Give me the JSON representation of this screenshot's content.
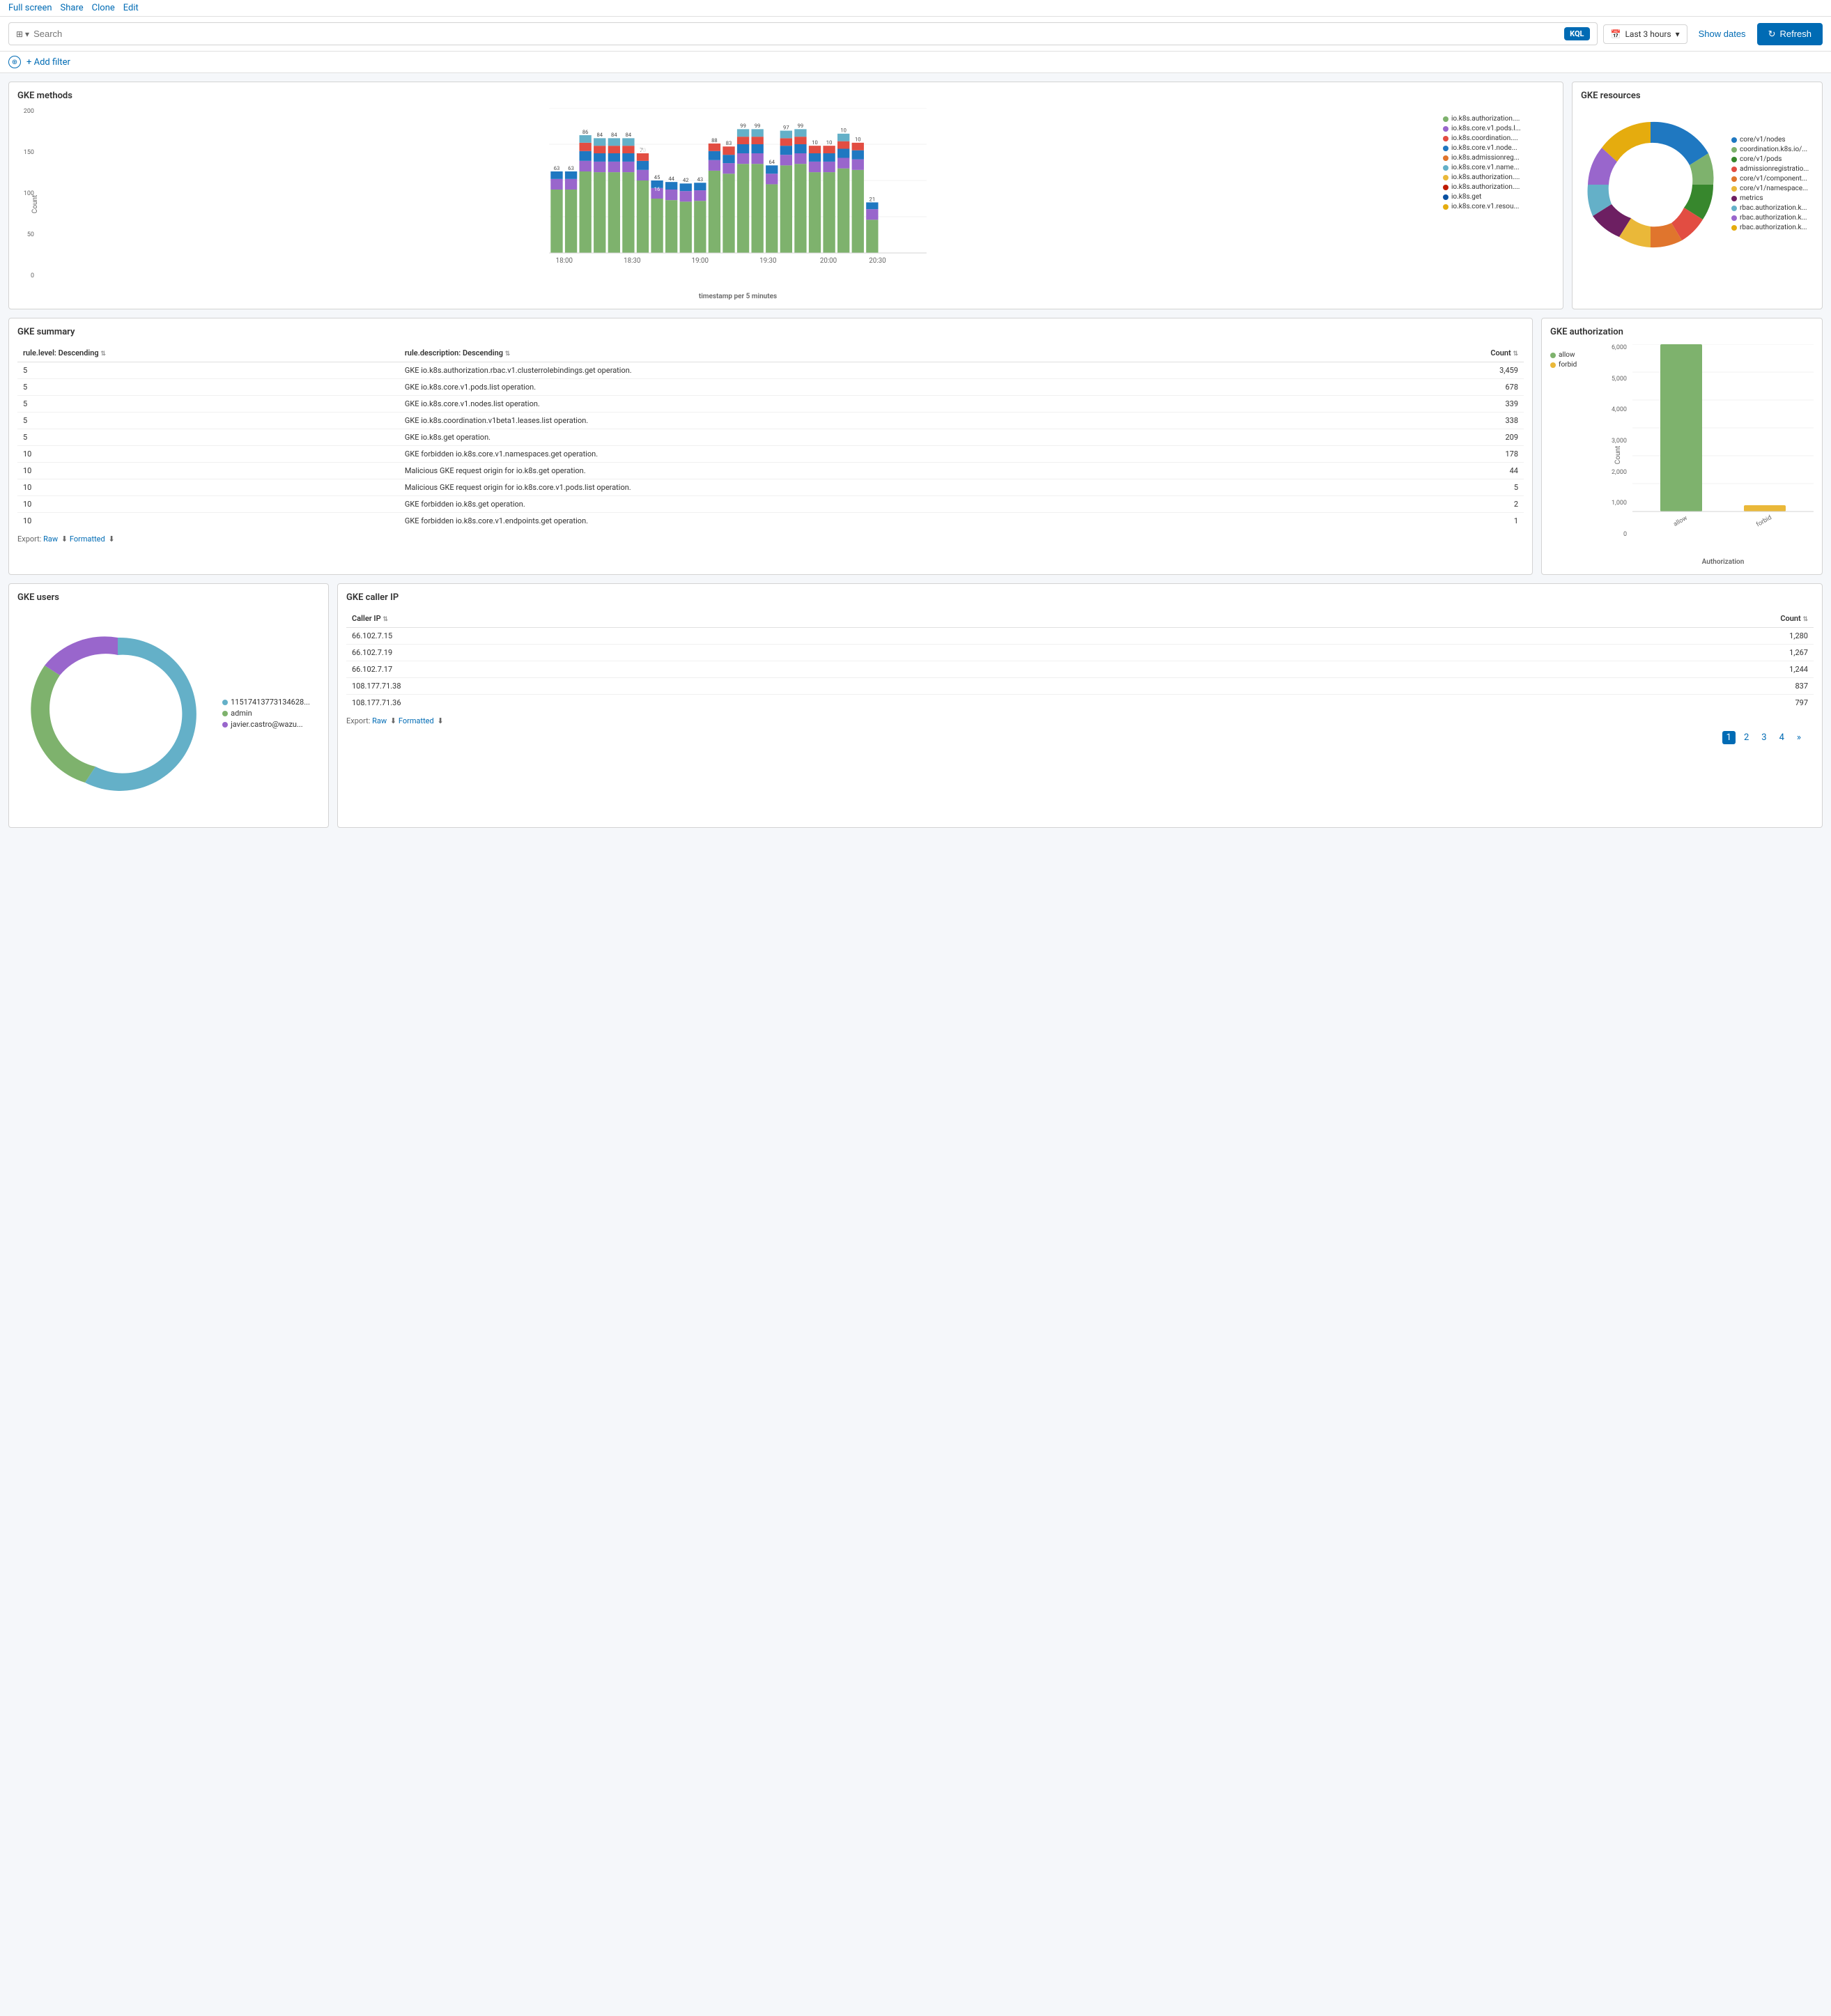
{
  "topbar": {
    "fullscreen": "Full screen",
    "share": "Share",
    "clone": "Clone",
    "edit": "Edit"
  },
  "toolbar": {
    "search_placeholder": "Search",
    "kql_label": "KQL",
    "calendar_icon": "calendar",
    "time_range": "Last 3 hours",
    "show_dates": "Show dates",
    "refresh": "Refresh"
  },
  "filterbar": {
    "add_filter": "+ Add filter"
  },
  "gke_methods": {
    "title": "GKE methods",
    "y_label": "Count",
    "x_label": "timestamp per 5 minutes",
    "legend": [
      {
        "label": "io.k8s.authorization....",
        "color": "#7eb26d"
      },
      {
        "label": "io.k8s.core.v1.pods.l...",
        "color": "#9966cc"
      },
      {
        "label": "io.k8s.coordination....",
        "color": "#e24d42"
      },
      {
        "label": "io.k8s.core.v1.node...",
        "color": "#1f78c1"
      },
      {
        "label": "io.k8s.admissionreg...",
        "color": "#e0752d"
      },
      {
        "label": "io.k8s.core.v1.name...",
        "color": "#64b0c8"
      },
      {
        "label": "io.k8s.authorization....",
        "color": "#eab839"
      },
      {
        "label": "io.k8s.authorization....",
        "color": "#bf1b00"
      },
      {
        "label": "io.k8s.get",
        "color": "#0a50a1"
      },
      {
        "label": "io.k8s.core.v1.resou...",
        "color": "#e5ac0e"
      }
    ],
    "x_ticks": [
      "18:00",
      "18:30",
      "19:00",
      "19:30",
      "20:00",
      "20:30"
    ]
  },
  "gke_resources": {
    "title": "GKE resources",
    "legend": [
      {
        "label": "core/v1/nodes",
        "color": "#1f78c1"
      },
      {
        "label": "coordination.k8s.io/...",
        "color": "#7eb26d"
      },
      {
        "label": "core/v1/pods",
        "color": "#37872d"
      },
      {
        "label": "admissionregistratio...",
        "color": "#e24d42"
      },
      {
        "label": "core/v1/component...",
        "color": "#e0752d"
      },
      {
        "label": "core/v1/namespace...",
        "color": "#eab839"
      },
      {
        "label": "metrics",
        "color": "#6d1f62"
      },
      {
        "label": "rbac.authorization.k...",
        "color": "#64b0c8"
      },
      {
        "label": "rbac.authorization.k...",
        "color": "#9966cc"
      },
      {
        "label": "rbac.authorization.k...",
        "color": "#e5ac0e"
      }
    ]
  },
  "gke_summary": {
    "title": "GKE summary",
    "columns": [
      "rule.level: Descending",
      "rule.description: Descending",
      "Count"
    ],
    "rows": [
      {
        "level": "5",
        "description": "GKE io.k8s.authorization.rbac.v1.clusterrolebindings.get operation.",
        "count": "3,459"
      },
      {
        "level": "5",
        "description": "GKE io.k8s.core.v1.pods.list operation.",
        "count": "678"
      },
      {
        "level": "5",
        "description": "GKE io.k8s.core.v1.nodes.list operation.",
        "count": "339"
      },
      {
        "level": "5",
        "description": "GKE io.k8s.coordination.v1beta1.leases.list operation.",
        "count": "338"
      },
      {
        "level": "5",
        "description": "GKE io.k8s.get operation.",
        "count": "209"
      },
      {
        "level": "10",
        "description": "GKE forbidden io.k8s.core.v1.namespaces.get operation.",
        "count": "178"
      },
      {
        "level": "10",
        "description": "Malicious GKE request origin for io.k8s.get operation.",
        "count": "44"
      },
      {
        "level": "10",
        "description": "Malicious GKE request origin for io.k8s.core.v1.pods.list operation.",
        "count": "5"
      },
      {
        "level": "10",
        "description": "GKE forbidden io.k8s.get operation.",
        "count": "2"
      },
      {
        "level": "10",
        "description": "GKE forbidden io.k8s.core.v1.endpoints.get operation.",
        "count": "1"
      }
    ],
    "export_label": "Export:",
    "raw_label": "Raw",
    "formatted_label": "Formatted"
  },
  "gke_authorization": {
    "title": "GKE authorization",
    "y_label": "Count",
    "x_label": "Authorization",
    "legend": [
      {
        "label": "allow",
        "color": "#7eb26d"
      },
      {
        "label": "forbid",
        "color": "#eab839"
      }
    ],
    "bars": [
      {
        "label": "allow",
        "value": 6400,
        "color": "#7eb26d"
      },
      {
        "label": "forbid",
        "value": 230,
        "color": "#eab839"
      }
    ],
    "y_ticks": [
      "0",
      "1,000",
      "2,000",
      "3,000",
      "4,000",
      "5,000",
      "6,000"
    ]
  },
  "gke_users": {
    "title": "GKE users",
    "legend": [
      {
        "label": "11517413773134628...",
        "color": "#64b0c8"
      },
      {
        "label": "admin",
        "color": "#7eb26d"
      },
      {
        "label": "javier.castro@wazu...",
        "color": "#9966cc"
      }
    ],
    "segments": [
      {
        "pct": 68,
        "color": "#64b0c8"
      },
      {
        "pct": 28,
        "color": "#7eb26d"
      },
      {
        "pct": 4,
        "color": "#9966cc"
      }
    ]
  },
  "gke_caller_ip": {
    "title": "GKE caller IP",
    "columns": [
      "Caller IP",
      "Count"
    ],
    "rows": [
      {
        "ip": "66.102.7.15",
        "count": "1,280"
      },
      {
        "ip": "66.102.7.19",
        "count": "1,267"
      },
      {
        "ip": "66.102.7.17",
        "count": "1,244"
      },
      {
        "ip": "108.177.71.38",
        "count": "837"
      },
      {
        "ip": "108.177.71.36",
        "count": "797"
      }
    ],
    "export_label": "Export:",
    "raw_label": "Raw",
    "formatted_label": "Formatted",
    "pagination": [
      "1",
      "2",
      "3",
      "4",
      "»"
    ]
  }
}
